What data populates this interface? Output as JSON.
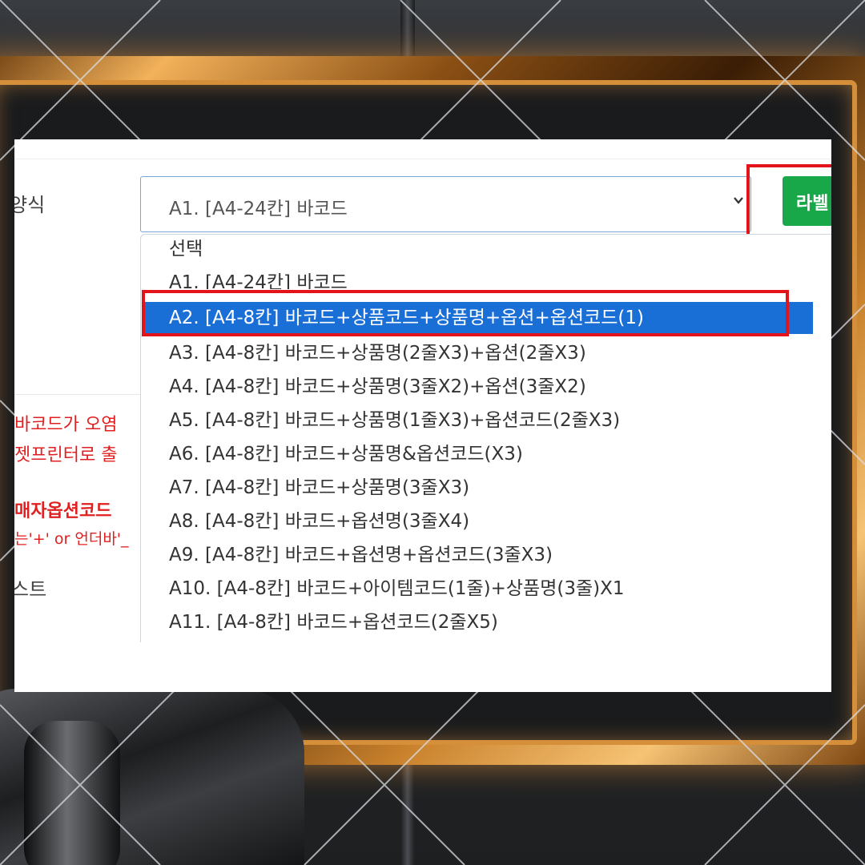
{
  "form": {
    "format_label": "양식",
    "format_select_value": "A1. [A4-24칸] 바코드",
    "print_button_label": "라벨",
    "warning_lines": [
      "바코드가 오염",
      "젯프린터로 출",
      "매자옵션코드",
      "는'+' or 언더바'_"
    ],
    "test_label": "스트"
  },
  "dropdown": {
    "options": [
      "선택",
      "A1. [A4-24칸] 바코드",
      "A2. [A4-8칸] 바코드+상품코드+상품명+옵션+옵션코드(1)",
      "A3. [A4-8칸] 바코드+상품명(2줄X3)+옵션(2줄X3)",
      "A4. [A4-8칸] 바코드+상품명(3줄X2)+옵션(3줄X2)",
      "A5. [A4-8칸] 바코드+상품명(1줄X3)+옵션코드(2줄X3)",
      "A6. [A4-8칸] 바코드+상품명&옵션코드(X3)",
      "A7. [A4-8칸] 바코드+상품명(3줄X3)",
      "A8. [A4-8칸] 바코드+옵션명(3줄X4)",
      "A9. [A4-8칸] 바코드+옵션명+옵션코드(3줄X3)",
      "A10. [A4-8칸] 바코드+아이템코드(1줄)+상품명(3줄)X1",
      "A11. [A4-8칸] 바코드+옵션코드(2줄X5)"
    ],
    "highlighted_index": 2
  },
  "colors": {
    "highlight": "#1a6fd6",
    "annotation_red": "#e3131b",
    "button_green": "#18a84a",
    "warning_text": "#e02020"
  }
}
